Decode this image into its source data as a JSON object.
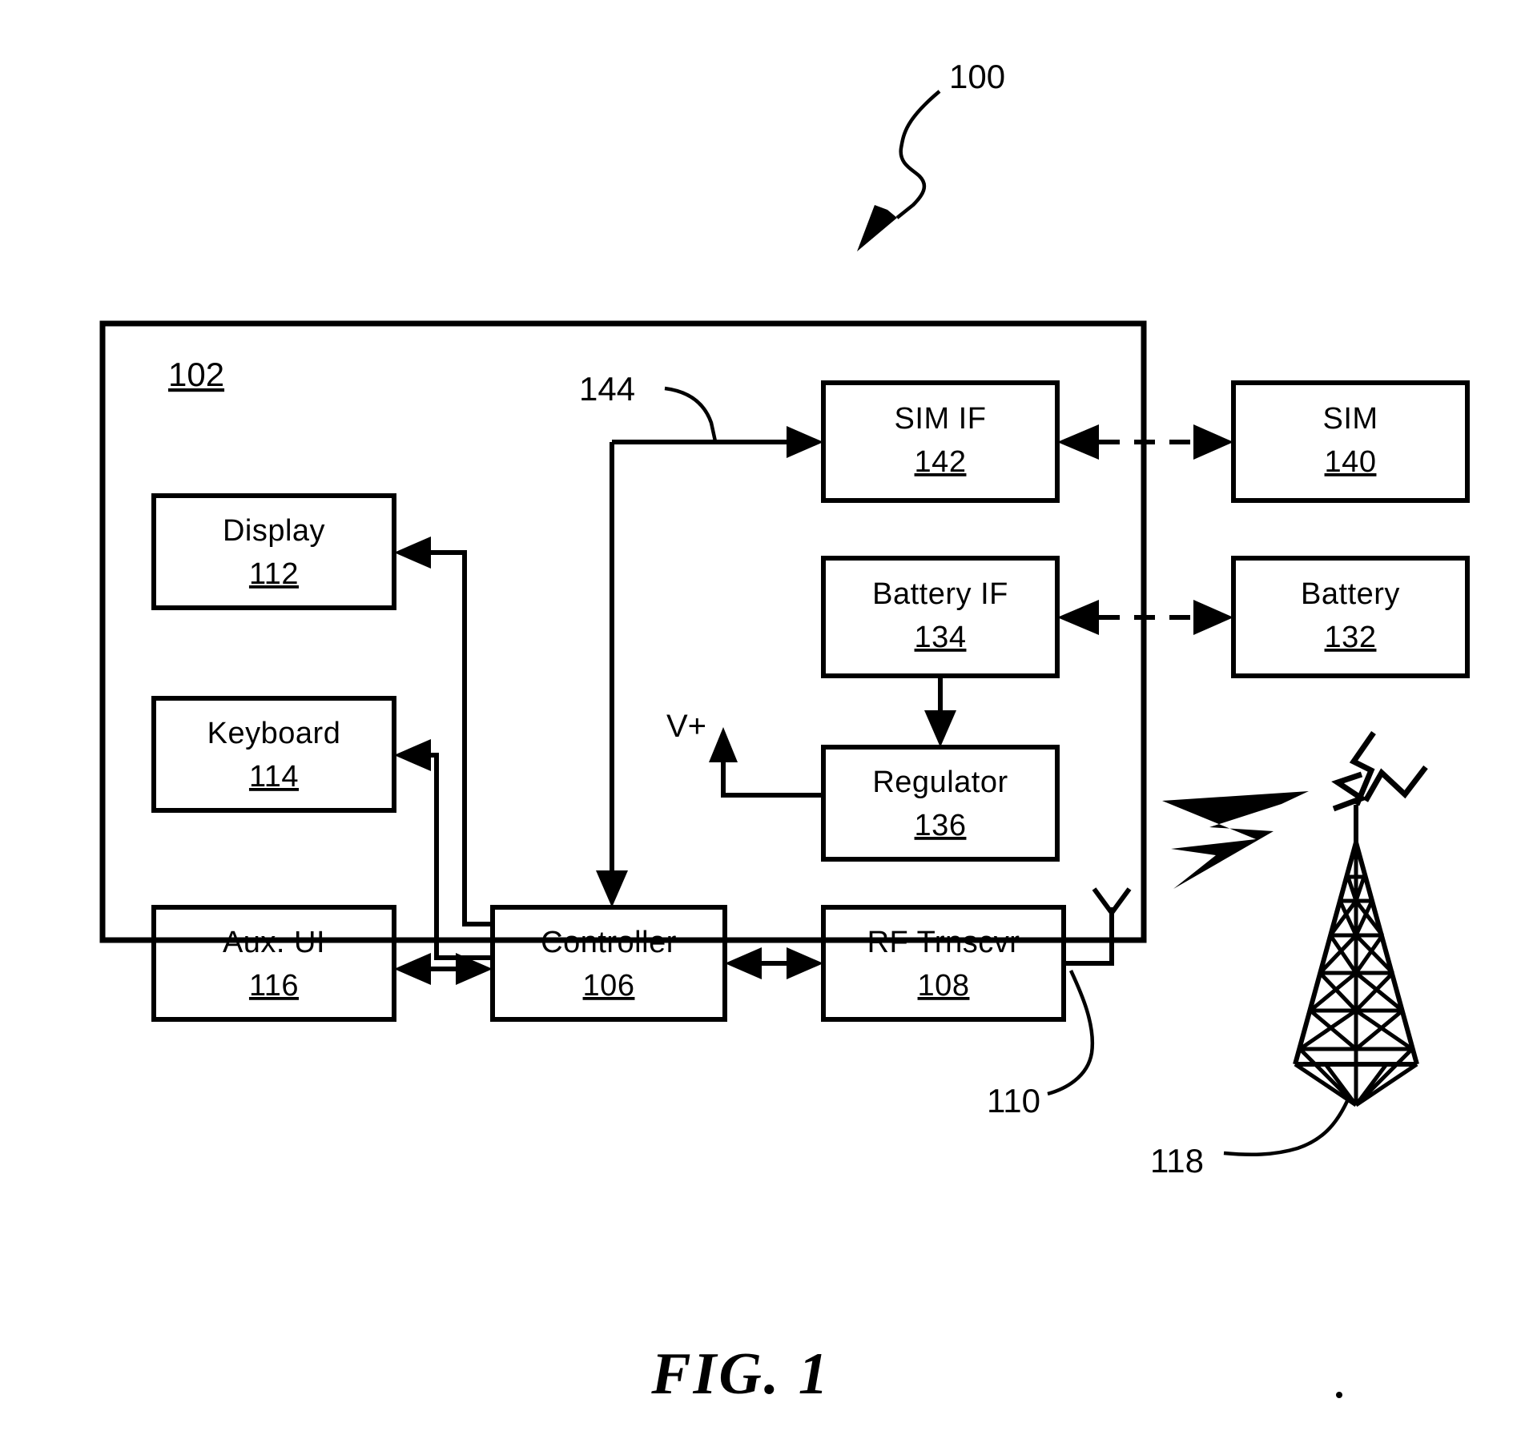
{
  "figure": {
    "caption": "FIG.  1",
    "top_reference": "100",
    "enclosure_reference": "102"
  },
  "blocks": [
    {
      "id": "display",
      "label": "Display",
      "number": "112"
    },
    {
      "id": "keyboard",
      "label": "Keyboard",
      "number": "114"
    },
    {
      "id": "aux_ui",
      "label": "Aux.  UI",
      "number": "116"
    },
    {
      "id": "controller",
      "label": "Controller",
      "number": "106"
    },
    {
      "id": "rf",
      "label": "RF  Trnscvr",
      "number": "108"
    },
    {
      "id": "sim_if",
      "label": "SIM  IF",
      "number": "142"
    },
    {
      "id": "battery_if",
      "label": "Battery  IF",
      "number": "134"
    },
    {
      "id": "regulator",
      "label": "Regulator",
      "number": "136"
    },
    {
      "id": "sim",
      "label": "SIM",
      "number": "140"
    },
    {
      "id": "battery",
      "label": "Battery",
      "number": "132"
    }
  ],
  "annotations": {
    "bus_reference": "144",
    "antenna_reference": "110",
    "tower_reference": "118",
    "supply_label": "V+"
  },
  "colors": {
    "ink": "#000000",
    "background": "#ffffff"
  }
}
